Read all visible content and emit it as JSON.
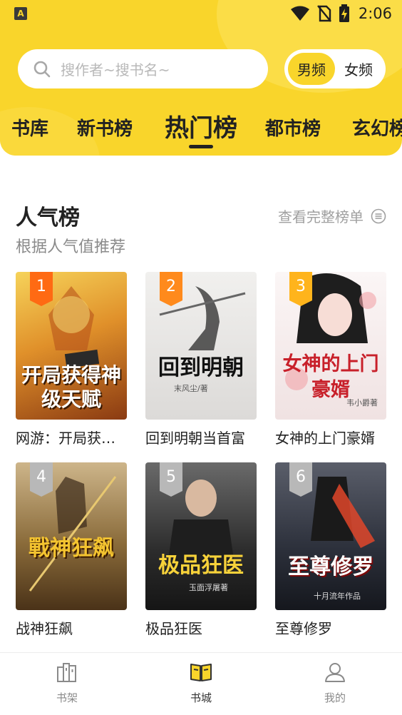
{
  "status": {
    "time": "2:06",
    "app_badge": "A"
  },
  "search": {
    "placeholder": "搜作者~搜书名~"
  },
  "gender": {
    "male": "男频",
    "female": "女频",
    "selected": "男频"
  },
  "tabs": [
    {
      "label": "书库",
      "active": false
    },
    {
      "label": "新书榜",
      "active": false
    },
    {
      "label": "热门榜",
      "active": true
    },
    {
      "label": "都市榜",
      "active": false
    },
    {
      "label": "玄幻榜",
      "active": false
    }
  ],
  "section": {
    "title": "人气榜",
    "subtitle": "根据人气值推荐",
    "more": "查看完整榜单"
  },
  "books": [
    {
      "rank": "1",
      "name": "网游：开局获…",
      "cover_title": "开局获得神级天赋",
      "cover_author": "",
      "cover_bg": "#d98a1c"
    },
    {
      "rank": "2",
      "name": "回到明朝当首富",
      "cover_title": "回到明朝",
      "cover_author": "末风尘/著",
      "cover_bg": "#e8e6e4"
    },
    {
      "rank": "3",
      "name": "女神的上门豪婿",
      "cover_title": "女神的上门豪婿",
      "cover_author": "韦小爵著",
      "cover_bg": "#f6eeee"
    },
    {
      "rank": "4",
      "name": "战神狂飙",
      "cover_title": "戰神狂飙",
      "cover_author": "",
      "cover_bg": "#7a5a2e"
    },
    {
      "rank": "5",
      "name": "极品狂医",
      "cover_title": "极品狂医",
      "cover_author": "玉面浮屠著",
      "cover_bg": "#3c3c3c"
    },
    {
      "rank": "6",
      "name": "至尊修罗",
      "cover_title": "至尊修罗",
      "cover_author": "十月流年作品",
      "cover_bg": "#2b2f3a"
    }
  ],
  "bottom_nav": [
    {
      "label": "书架",
      "icon": "bookshelf-icon",
      "active": false
    },
    {
      "label": "书城",
      "icon": "book-open-icon",
      "active": true
    },
    {
      "label": "我的",
      "icon": "user-icon",
      "active": false
    }
  ],
  "colors": {
    "accent": "#f9d52b",
    "rank_top": "#ff6a13",
    "rank_gray": "#b8b8b8"
  }
}
